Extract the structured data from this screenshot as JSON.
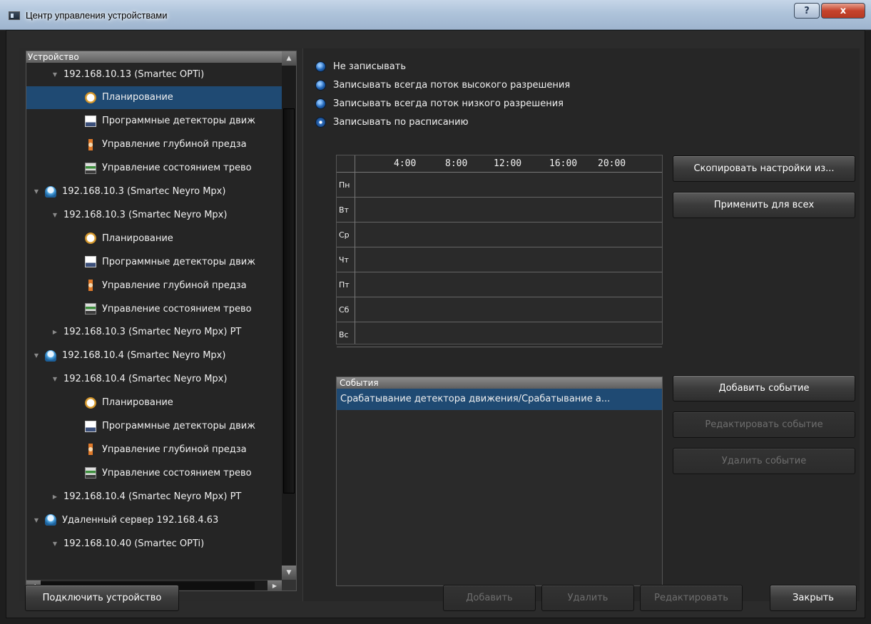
{
  "window": {
    "title": "Центр управления устройствами",
    "help_label": "?",
    "close_label": "x"
  },
  "tree": {
    "header": "Устройство",
    "rows": [
      {
        "label": "192.168.10.13 (Smartec OPTi)",
        "icon": "",
        "arrow": "▼",
        "selected": false
      },
      {
        "label": "Планирование",
        "icon": "clock-icon",
        "arrow": "",
        "selected": true
      },
      {
        "label": "Программные детекторы движ",
        "icon": "motion-detector-icon",
        "arrow": "",
        "selected": false
      },
      {
        "label": "Управление глубиной предза",
        "icon": "depth-icon",
        "arrow": "",
        "selected": false
      },
      {
        "label": "Управление состоянием трево",
        "icon": "alarm-icon",
        "arrow": "",
        "selected": false
      },
      {
        "label": "192.168.10.3 (Smartec Neyro Mpx)",
        "icon": "server-icon",
        "arrow": "▼",
        "selected": false
      },
      {
        "label": "192.168.10.3 (Smartec Neyro Mpx)",
        "icon": "",
        "arrow": "▼",
        "selected": false
      },
      {
        "label": "Планирование",
        "icon": "clock-icon",
        "arrow": "",
        "selected": false
      },
      {
        "label": "Программные детекторы движ",
        "icon": "motion-detector-icon",
        "arrow": "",
        "selected": false
      },
      {
        "label": "Управление глубиной предза",
        "icon": "depth-icon",
        "arrow": "",
        "selected": false
      },
      {
        "label": "Управление состоянием трево",
        "icon": "alarm-icon",
        "arrow": "",
        "selected": false
      },
      {
        "label": "192.168.10.3 (Smartec Neyro Mpx) PT",
        "icon": "",
        "arrow": "▶",
        "selected": false
      },
      {
        "label": "192.168.10.4 (Smartec Neyro Mpx)",
        "icon": "server-icon",
        "arrow": "▼",
        "selected": false
      },
      {
        "label": "192.168.10.4 (Smartec Neyro Mpx)",
        "icon": "",
        "arrow": "▼",
        "selected": false
      },
      {
        "label": "Планирование",
        "icon": "clock-icon",
        "arrow": "",
        "selected": false
      },
      {
        "label": "Программные детекторы движ",
        "icon": "motion-detector-icon",
        "arrow": "",
        "selected": false
      },
      {
        "label": "Управление глубиной предза",
        "icon": "depth-icon",
        "arrow": "",
        "selected": false
      },
      {
        "label": "Управление состоянием трево",
        "icon": "alarm-icon",
        "arrow": "",
        "selected": false
      },
      {
        "label": "192.168.10.4 (Smartec Neyro Mpx) PT",
        "icon": "",
        "arrow": "▶",
        "selected": false
      },
      {
        "label": "Удаленный сервер 192.168.4.63",
        "icon": "server-icon",
        "arrow": "▼",
        "selected": false
      },
      {
        "label": "192.168.10.40 (Smartec OPTi)",
        "icon": "",
        "arrow": "▼",
        "selected": false
      }
    ]
  },
  "recording": {
    "options": [
      {
        "label": "Не записывать",
        "checked": false
      },
      {
        "label": "Записывать всегда поток высокого разрешения",
        "checked": false
      },
      {
        "label": "Записывать всегда поток низкого разрешения",
        "checked": false
      },
      {
        "label": "Записывать по расписанию",
        "checked": true
      }
    ]
  },
  "schedule": {
    "hours": [
      "4:00",
      "8:00",
      "12:00",
      "16:00",
      "20:00"
    ],
    "days": [
      "Пн",
      "Вт",
      "Ср",
      "Чт",
      "Пт",
      "Сб",
      "Вс"
    ]
  },
  "schedule_buttons": {
    "copy_label": "Скопировать настройки из...",
    "apply_all_label": "Применить для всех"
  },
  "events": {
    "header": "События",
    "rows": [
      "Срабатывание детектора движения/Срабатывание а..."
    ],
    "add_label": "Добавить событие",
    "edit_label": "Редактировать событие",
    "delete_label": "Удалить событие"
  },
  "footer": {
    "connect_label": "Подключить устройство",
    "add_label": "Добавить",
    "delete_label": "Удалить",
    "edit_label": "Редактировать",
    "close_label": "Закрыть"
  }
}
